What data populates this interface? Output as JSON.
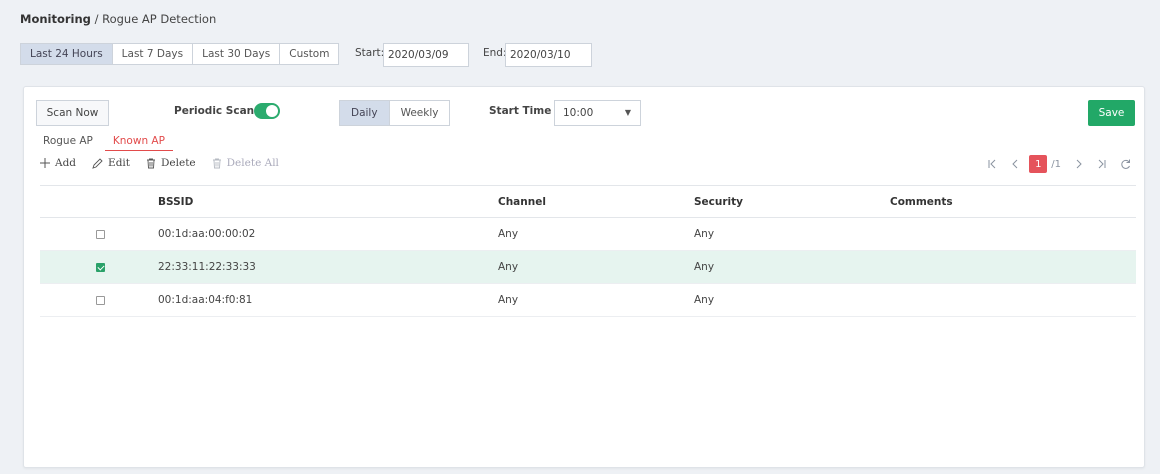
{
  "breadcrumb": {
    "section": "Monitoring",
    "separator": "/",
    "page": "Rogue AP Detection"
  },
  "date_range": {
    "ranges": [
      "Last 24 Hours",
      "Last 7 Days",
      "Last 30 Days",
      "Custom"
    ],
    "active_range": "Last 24 Hours",
    "start_label": "Start:",
    "start_value": "2020/03/09",
    "end_label": "End:",
    "end_value": "2020/03/10"
  },
  "scan": {
    "scan_now_label": "Scan Now",
    "periodic_label": "Periodic Scan",
    "periodic_enabled": true,
    "frequency_options": [
      "Daily",
      "Weekly"
    ],
    "frequency_selected": "Daily",
    "start_time_label": "Start Time",
    "start_time_value": "10:00",
    "save_label": "Save"
  },
  "tabs": [
    {
      "label": "Rogue AP",
      "active": false
    },
    {
      "label": "Known AP",
      "active": true
    }
  ],
  "toolbar": {
    "add": "Add",
    "edit": "Edit",
    "delete": "Delete",
    "delete_all": "Delete All"
  },
  "pager": {
    "current": "1",
    "total": "/1"
  },
  "table": {
    "headers": {
      "bssid": "BSSID",
      "channel": "Channel",
      "security": "Security",
      "comments": "Comments"
    },
    "rows": [
      {
        "bssid": "00:1d:aa:00:00:02",
        "channel": "Any",
        "security": "Any",
        "comments": "",
        "checked": false
      },
      {
        "bssid": "22:33:11:22:33:33",
        "channel": "Any",
        "security": "Any",
        "comments": "",
        "checked": true
      },
      {
        "bssid": "00:1d:aa:04:f0:81",
        "channel": "Any",
        "security": "Any",
        "comments": "",
        "checked": false
      }
    ]
  },
  "colors": {
    "accent_green": "#22a867",
    "tab_active": "#e24b4b",
    "page_active": "#e5535b",
    "selected_row": "#e6f4ef"
  }
}
